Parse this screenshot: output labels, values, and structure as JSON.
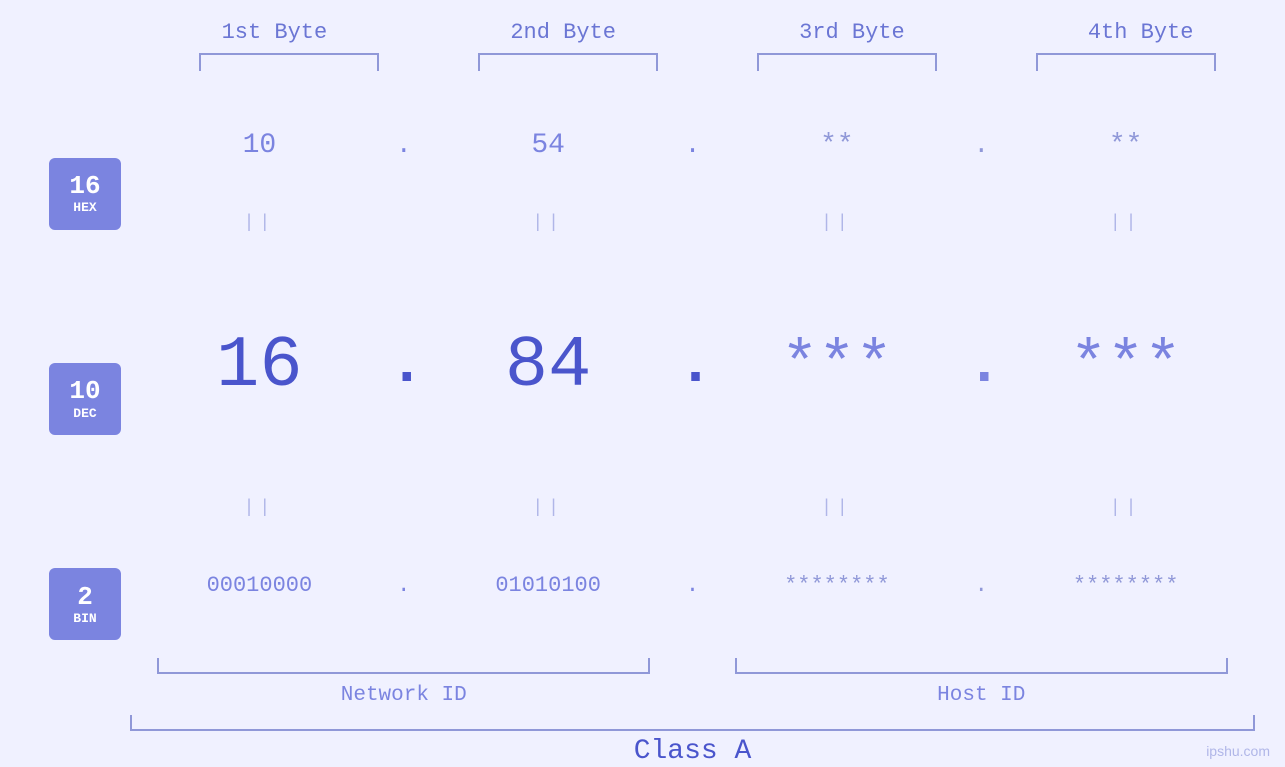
{
  "page": {
    "background": "#f0f1ff",
    "watermark": "ipshu.com"
  },
  "byteHeaders": [
    {
      "label": "1st Byte"
    },
    {
      "label": "2nd Byte"
    },
    {
      "label": "3rd Byte"
    },
    {
      "label": "4th Byte"
    }
  ],
  "badges": [
    {
      "num": "16",
      "label": "HEX"
    },
    {
      "num": "10",
      "label": "DEC"
    },
    {
      "num": "2",
      "label": "BIN"
    }
  ],
  "hexRow": {
    "byte1": "10",
    "byte2": "54",
    "byte3": "**",
    "byte4": "**",
    "sep": "."
  },
  "decRow": {
    "byte1": "16",
    "byte2": "84",
    "byte3": "***",
    "byte4": "***",
    "sep": "."
  },
  "binRow": {
    "byte1": "00010000",
    "byte2": "01010100",
    "byte3": "********",
    "byte4": "********",
    "sep": "."
  },
  "networkLabel": "Network ID",
  "hostLabel": "Host ID",
  "classLabel": "Class A"
}
